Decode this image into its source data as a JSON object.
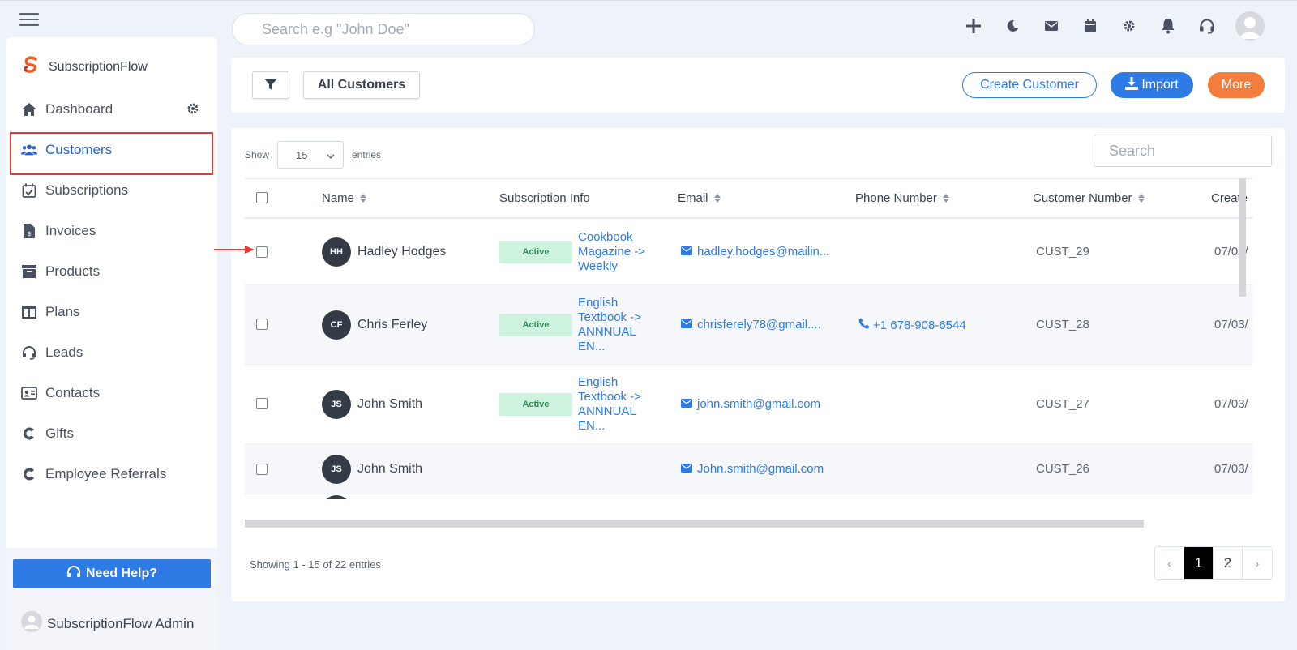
{
  "app": {
    "brand_name": "SubscriptionFlow",
    "search_placeholder": "Search e.g \"John Doe\""
  },
  "sidebar": {
    "items": [
      {
        "label": "Dashboard",
        "icon": "home-icon"
      },
      {
        "label": "Customers",
        "icon": "users-icon",
        "active": true
      },
      {
        "label": "Subscriptions",
        "icon": "calendar-check-icon"
      },
      {
        "label": "Invoices",
        "icon": "invoice-icon"
      },
      {
        "label": "Products",
        "icon": "archive-icon"
      },
      {
        "label": "Plans",
        "icon": "columns-icon"
      },
      {
        "label": "Leads",
        "icon": "headset-icon"
      },
      {
        "label": "Contacts",
        "icon": "id-card-icon"
      },
      {
        "label": "Gifts",
        "icon": "c-logo-icon"
      },
      {
        "label": "Employee Referrals",
        "icon": "c-logo-icon"
      }
    ],
    "help_label": "Need Help?",
    "admin_name": "SubscriptionFlow Admin"
  },
  "toolbar": {
    "view_label": "All Customers",
    "create_label": "Create Customer",
    "import_label": "Import",
    "more_label": "More"
  },
  "table": {
    "show_label": "Show",
    "entries_value": "15",
    "entries_label": "entries",
    "search_placeholder": "Search",
    "columns": [
      "Name",
      "Subscription Info",
      "Email",
      "Phone Number",
      "Customer Number",
      "Create"
    ],
    "rows": [
      {
        "initials": "HH",
        "name": "Hadley Hodges",
        "status": "Active",
        "plan": "Cookbook Magazine -> Weekly",
        "email": "hadley.hodges@mailin...",
        "phone": "",
        "customer_number": "CUST_29",
        "created": "07/03/"
      },
      {
        "initials": "CF",
        "name": "Chris Ferley",
        "status": "Active",
        "plan": "English Textbook -> ANNNUAL EN...",
        "email": "chrisferely78@gmail....",
        "phone": "+1 678-908-6544",
        "customer_number": "CUST_28",
        "created": "07/03/"
      },
      {
        "initials": "JS",
        "name": "John Smith",
        "status": "Active",
        "plan": "English Textbook -> ANNNUAL EN...",
        "email": "john.smith@gmail.com",
        "phone": "",
        "customer_number": "CUST_27",
        "created": "07/03/"
      },
      {
        "initials": "JS",
        "name": "John Smith",
        "status": "",
        "plan": "",
        "email": "John.smith@gmail.com",
        "phone": "",
        "customer_number": "CUST_26",
        "created": "07/03/"
      }
    ],
    "showing_text": "Showing 1 - 15 of 22 entries",
    "pagination": {
      "prev": "‹",
      "pages": [
        "1",
        "2"
      ],
      "next": "›",
      "current": "1"
    }
  },
  "colors": {
    "primary": "#2f7be6",
    "accent_orange": "#f47c3c",
    "active_badge_bg": "#cdf3de",
    "active_badge_text": "#2e8b57",
    "highlight_red": "#e53935"
  }
}
